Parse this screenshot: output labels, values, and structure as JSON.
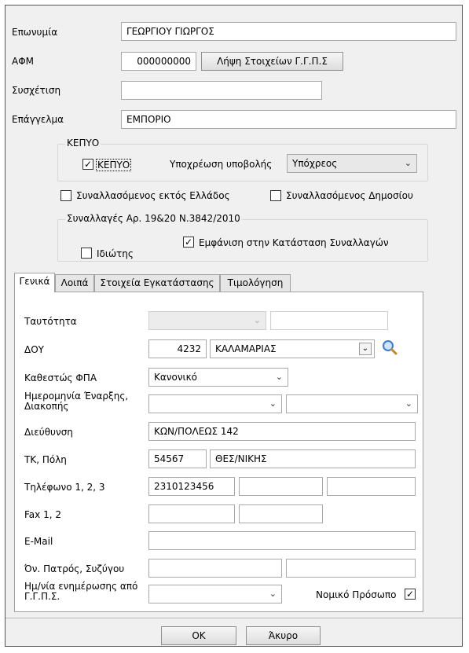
{
  "fields": {
    "eponymia_label": "Επωνυμία",
    "eponymia_value": "ΓΕΩΡΓΙΟΥ ΓΙΩΡΓΟΣ",
    "afm_label": "ΑΦΜ",
    "afm_value": "000000000",
    "fetch_button": "Λήψη Στοιχείων Γ.Γ.Π.Σ",
    "sysxetisi_label": "Συσχέτιση",
    "sysxetisi_value": "",
    "epaggelma_label": "Επάγγελμα",
    "epaggelma_value": "ΕΜΠΟΡΙΟ"
  },
  "kepyo": {
    "group_title": "ΚΕΠΥΟ",
    "check_label": "ΚΕΠΥΟ",
    "check_checked": true,
    "obligation_label": "Υποχρέωση υποβολής",
    "obligation_value": "Υπόχρεος"
  },
  "options": {
    "abroad_label": "Συναλλασόμενος εκτός Ελλάδος",
    "abroad_checked": false,
    "public_label": "Συναλλασόμενος Δημοσίου",
    "public_checked": false
  },
  "transactions": {
    "group_title": "Συναλλαγές Αρ. 19&20 Ν.3842/2010",
    "private_label": "Ιδιώτης",
    "private_checked": false,
    "show_label": "Εμφάνιση στην Κατάσταση Συναλλαγών",
    "show_checked": true
  },
  "tabs": [
    {
      "label": "Γενικά",
      "active": true
    },
    {
      "label": "Λοιπά",
      "active": false
    },
    {
      "label": "Στοιχεία Εγκατάστασης",
      "active": false
    },
    {
      "label": "Τιμολόγηση",
      "active": false
    }
  ],
  "general": {
    "identity_label": "Ταυτότητα",
    "doy_label": "ΔΟΥ",
    "doy_code": "4232",
    "doy_name": "ΚΑΛΑΜΑΡΙΑΣ",
    "vat_label": "Καθεστώς ΦΠΑ",
    "vat_value": "Κανονικό",
    "dates_label": "Ημερομηνία Έναρξης, Διακοπής",
    "address_label": "Διεύθυνση",
    "address_value": "ΚΩΝ/ΠΟΛΕΩΣ 142",
    "tk_label": "ΤΚ, Πόλη",
    "tk_value": "54567",
    "city_value": "ΘΕΣ/ΝΙΚΗΣ",
    "phone_label": "Τηλέφωνο 1, 2, 3",
    "phone1_value": "2310123456",
    "fax_label": "Fax 1, 2",
    "email_label": "E-Mail",
    "father_label": "Όν. Πατρός, Συζύγου",
    "update_label": "Ημ/νία ενημέρωσης από Γ.Γ.Π.Σ.",
    "legal_label": "Νομικό Πρόσωπο",
    "legal_checked": true
  },
  "footer": {
    "ok_label": "OK",
    "cancel_label": "Άκυρο"
  },
  "colors": {
    "window_bg": "#f0f0f0",
    "panel_bg": "#ffffff",
    "search_icon": "#3a7bd5"
  }
}
